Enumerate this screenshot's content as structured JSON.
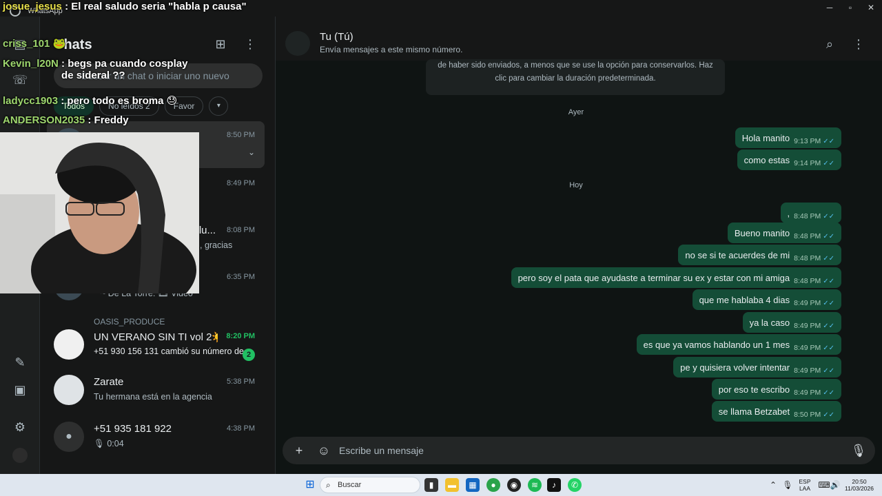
{
  "window": {
    "app_name": "WhatsApp"
  },
  "list": {
    "title": "Chats",
    "search_placeholder": "Buscar un chat o iniciar uno nuevo",
    "filters": [
      "Todos",
      "No leídos 2",
      "Favor"
    ],
    "chats": [
      {
        "name": "",
        "preview": "",
        "time": "8:50 PM",
        "unread": false
      },
      {
        "name": "",
        "preview": "",
        "time": "8:49 PM",
        "unread": false
      },
      {
        "name": "...alu...",
        "preview": ", gracias",
        "time": "8:08 PM",
        "unread": false
      },
      {
        "name": "",
        "preview": "~ De La Torre: 🎞 Video",
        "time": "6:35 PM",
        "unread": false
      },
      {
        "org": "OASIS_PRODUCE",
        "name": "UN VERANO SIN TI vol 2☀️🏝",
        "preview": "+51 930 156 131 cambió su número de ...",
        "time": "8:20 PM",
        "unread": true,
        "badge": "2"
      },
      {
        "name": "Zarate",
        "preview": "Tu hermana está en la agencia",
        "time": "5:38 PM",
        "unread": false
      },
      {
        "name": "+51 935 181 922",
        "preview": "🎙 0:04",
        "time": "4:38 PM",
        "unread": false
      }
    ]
  },
  "conversation": {
    "title": "Tu (Tú)",
    "subtitle": "Envía mensajes a este mismo número.",
    "notice": "de haber sido enviados, a menos que se use la opción para conservarlos. Haz clic para cambiar la duración predeterminada.",
    "day_yesterday": "Ayer",
    "day_today": "Hoy",
    "messages": [
      {
        "text": "Hola manito",
        "time": "9:13 PM"
      },
      {
        "text": "como estas",
        "time": "9:14 PM"
      },
      {
        "text": ",",
        "time": "8:48 PM"
      },
      {
        "text": "Bueno manito",
        "time": "8:48 PM"
      },
      {
        "text": "no se si te acuerdes de mi",
        "time": "8:48 PM"
      },
      {
        "text": "pero soy el pata que ayudaste a terminar su ex y estar con mi amiga",
        "time": "8:48 PM"
      },
      {
        "text": "que me hablaba 4 dias",
        "time": "8:49 PM"
      },
      {
        "text": "ya la caso",
        "time": "8:49 PM"
      },
      {
        "text": "es que ya vamos hablando un 1 mes",
        "time": "8:49 PM"
      },
      {
        "text": "pe y quisiera volver intentar",
        "time": "8:49 PM"
      },
      {
        "text": "por eso te escribo",
        "time": "8:49 PM"
      },
      {
        "text": "se llama Betzabet",
        "time": "8:50 PM"
      }
    ],
    "composer_placeholder": "Escribe un mensaje"
  },
  "stream_chat": [
    {
      "user": "josue_jesus",
      "text": ": El real saludo seria \"habla p causa\""
    },
    {
      "user": "criss_101",
      "text": "🐸"
    },
    {
      "user": "Kevin_l20N",
      "text": ": begs pa cuando cosplay de sideral ??"
    },
    {
      "user": "ladycc1903",
      "text": ": pero todo es broma 😓"
    },
    {
      "user": "ANDERSON2035",
      "text": ": Freddy"
    }
  ],
  "taskbar": {
    "search_label": "Buscar",
    "lang_top": "ESP",
    "lang_bottom": "LAA",
    "time": "20:50",
    "date": "11/03/2026"
  },
  "colors": {
    "accent": "#21c063",
    "outgoing_bubble": "#144d37",
    "tick_read": "#53bdeb"
  }
}
